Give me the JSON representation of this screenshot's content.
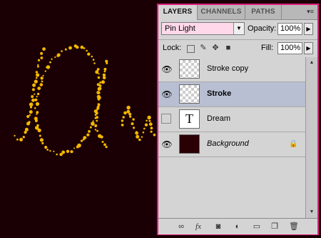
{
  "panel": {
    "tabs": [
      {
        "label": "LAYERS"
      },
      {
        "label": "CHANNELS"
      },
      {
        "label": "PATHS"
      }
    ],
    "menu_icon": "panel-menu-icon",
    "blend_mode": "Pin Light",
    "opacity_label": "Opacity:",
    "opacity_value": "100%",
    "lock_label": "Lock:",
    "fill_label": "Fill:",
    "fill_value": "100%"
  },
  "layers": [
    {
      "name": "Stroke copy",
      "visible": true,
      "thumb": "transparent",
      "selected": false
    },
    {
      "name": "Stroke",
      "visible": true,
      "thumb": "transparent",
      "selected": true
    },
    {
      "name": "Dream",
      "visible": false,
      "thumb": "text",
      "thumb_glyph": "T",
      "selected": false
    },
    {
      "name": "Background",
      "visible": true,
      "thumb": "dark",
      "selected": false,
      "locked": true
    }
  ],
  "bottom_icons": [
    "link-layers-icon",
    "fx-icon",
    "layer-mask-icon",
    "adjustment-layer-icon",
    "group-folder-icon",
    "new-layer-icon",
    "trash-icon"
  ],
  "colors": {
    "accent_border": "#e0207a",
    "canvas_bg": "#1a0004",
    "glitter": "#f5b800",
    "selected_layer": "#b9bfd2"
  }
}
